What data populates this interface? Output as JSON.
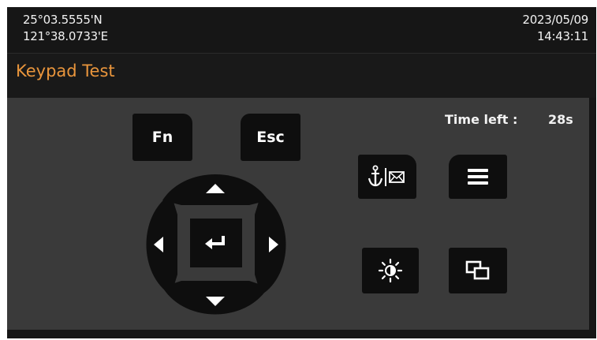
{
  "status": {
    "latitude": "25°03.5555'N",
    "longitude": "121°38.0733'E",
    "date": "2023/05/09",
    "time": "14:43:11"
  },
  "title": "Keypad Test",
  "timer": {
    "label": "Time left :",
    "value": "28s"
  },
  "keys": {
    "fn": "Fn",
    "esc": "Esc",
    "up": "up-arrow-icon",
    "down": "down-arrow-icon",
    "left": "left-arrow-icon",
    "right": "right-arrow-icon",
    "enter": "enter-icon",
    "anchor_mail": "anchor-mail-icon",
    "menu": "menu-icon",
    "brightness": "brightness-icon",
    "windows": "windows-icon"
  },
  "colors": {
    "title": "#e9953c",
    "panel": "#3a3a3a",
    "key": "#0e0e0e"
  }
}
